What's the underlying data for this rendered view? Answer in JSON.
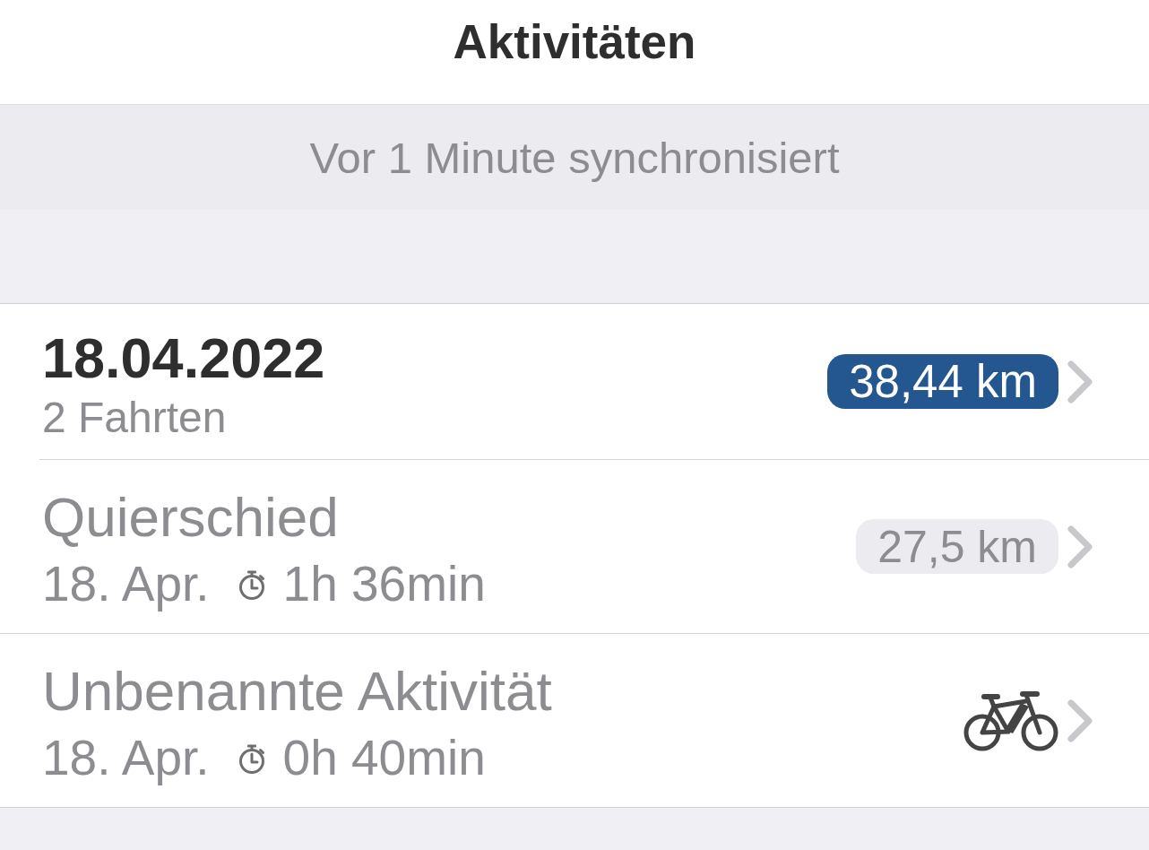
{
  "header": {
    "title": "Aktivitäten"
  },
  "sync_status": "Vor 1 Minute synchronisiert",
  "list": [
    {
      "kind": "day",
      "date": "18.04.2022",
      "subtitle": "2 Fahrten",
      "distance": "38,44 km"
    },
    {
      "kind": "activity",
      "title": "Quierschied",
      "date": "18. Apr.",
      "duration": "1h 36min",
      "distance": "27,5 km"
    },
    {
      "kind": "activity",
      "title": "Unbenannte Aktivität",
      "date": "18. Apr.",
      "duration": "0h 40min"
    }
  ]
}
